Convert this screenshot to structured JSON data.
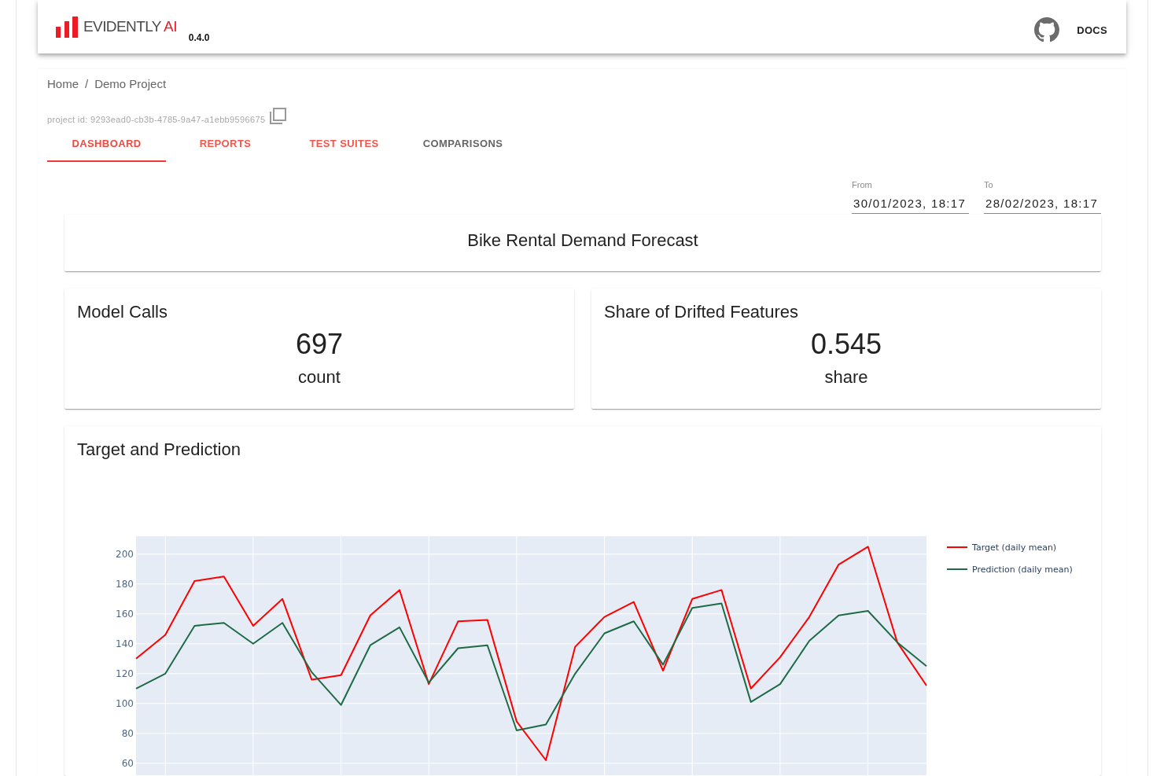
{
  "header": {
    "logo_text": "EVIDENTLY",
    "logo_accent": "AI",
    "version": "0.4.0",
    "docs_link": "DOCS"
  },
  "breadcrumb": {
    "items": [
      "Home",
      "Demo Project"
    ],
    "separator": "/"
  },
  "project_id": "project id: 9293ead0-cb3b-4785-9a47-a1ebb9596675",
  "tabs": [
    {
      "label": "DASHBOARD",
      "selected": true,
      "disabled": false
    },
    {
      "label": "REPORTS",
      "selected": false,
      "disabled": false
    },
    {
      "label": "TEST SUITES",
      "selected": false,
      "disabled": false
    },
    {
      "label": "COMPARISONS",
      "selected": false,
      "disabled": true
    }
  ],
  "date_range": [
    {
      "label": "From",
      "value": "30/01/2023, 18:17"
    },
    {
      "label": "To",
      "value": "28/02/2023, 18:17"
    }
  ],
  "panels": [
    {
      "kind": "title",
      "text": "Bike Rental Demand Forecast"
    },
    {
      "kind": "counter",
      "title": "Model Calls",
      "value": "697",
      "unit": "count"
    },
    {
      "kind": "counter",
      "title": "Share of Drifted Features",
      "value": "0.545",
      "unit": "share"
    },
    {
      "kind": "plot",
      "title": "Target and Prediction",
      "chart_data": {
        "type": "line",
        "categories": [
          null,
          null,
          null,
          null,
          null,
          null,
          null,
          null,
          null,
          null,
          null,
          null,
          null,
          null,
          null,
          null,
          null,
          null,
          null,
          null,
          null,
          null,
          null,
          null,
          null,
          null,
          null,
          null
        ],
        "series": [
          {
            "name": "Target (daily mean)",
            "color": "#ff0000",
            "values": [
              130,
              146,
              182,
              185,
              152,
              170,
              116,
              119,
              159,
              176,
              113,
              155,
              156,
              88,
              62,
              138,
              158,
              168,
              122,
              170,
              176,
              110,
              131,
              158,
              193,
              205,
              141,
              112
            ]
          },
          {
            "name": "Prediction (daily mean)",
            "color": "#1e6b45",
            "values": [
              110,
              120,
              152,
              154,
              140,
              154,
              121,
              99,
              139,
              151,
              114,
              137,
              139,
              82,
              86,
              120,
              147,
              155,
              126,
              164,
              167,
              101,
              113,
              142,
              159,
              162,
              141,
              125
            ]
          }
        ],
        "ylim": [
          52,
          212
        ],
        "yticks": [
          60,
          80,
          100,
          120,
          140,
          160,
          180,
          200
        ],
        "tick_labels": "y",
        "grid": true,
        "legend": "right"
      }
    }
  ]
}
